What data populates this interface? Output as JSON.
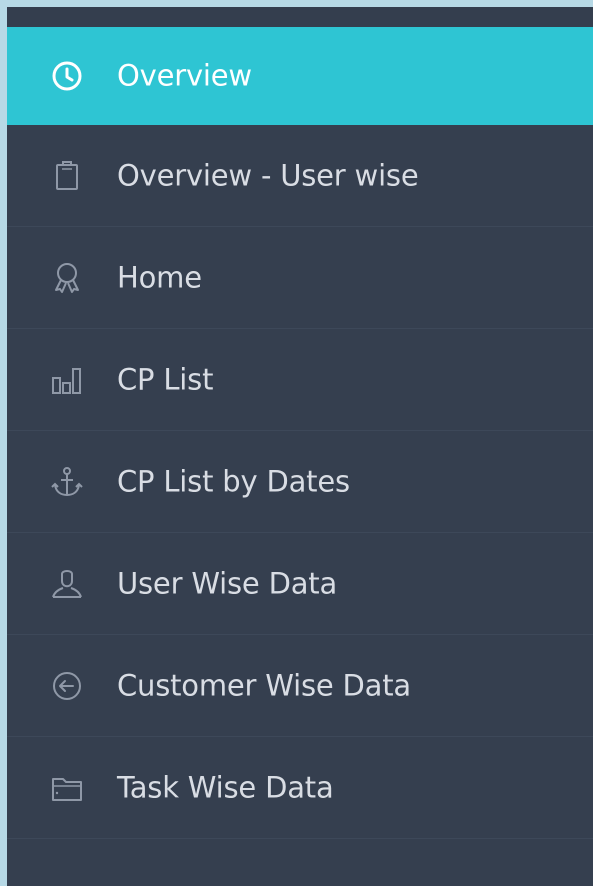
{
  "sidebar": {
    "items": [
      {
        "label": "Overview",
        "icon": "clock-icon",
        "active": true
      },
      {
        "label": "Overview - User wise",
        "icon": "clipboard-icon",
        "active": false
      },
      {
        "label": "Home",
        "icon": "award-ribbon-icon",
        "active": false
      },
      {
        "label": "CP List",
        "icon": "bar-chart-icon",
        "active": false
      },
      {
        "label": "CP List by Dates",
        "icon": "anchor-icon",
        "active": false
      },
      {
        "label": "User Wise Data",
        "icon": "user-icon",
        "active": false
      },
      {
        "label": "Customer Wise Data",
        "icon": "arrow-left-circle-icon",
        "active": false
      },
      {
        "label": "Task Wise Data",
        "icon": "folder-icon",
        "active": false
      }
    ]
  },
  "colors": {
    "page_background": "#b7d9e6",
    "sidebar_background": "#353f4f",
    "active_background": "#2ec5d3",
    "text": "#d9dde4",
    "icon": "#8f98a7"
  }
}
